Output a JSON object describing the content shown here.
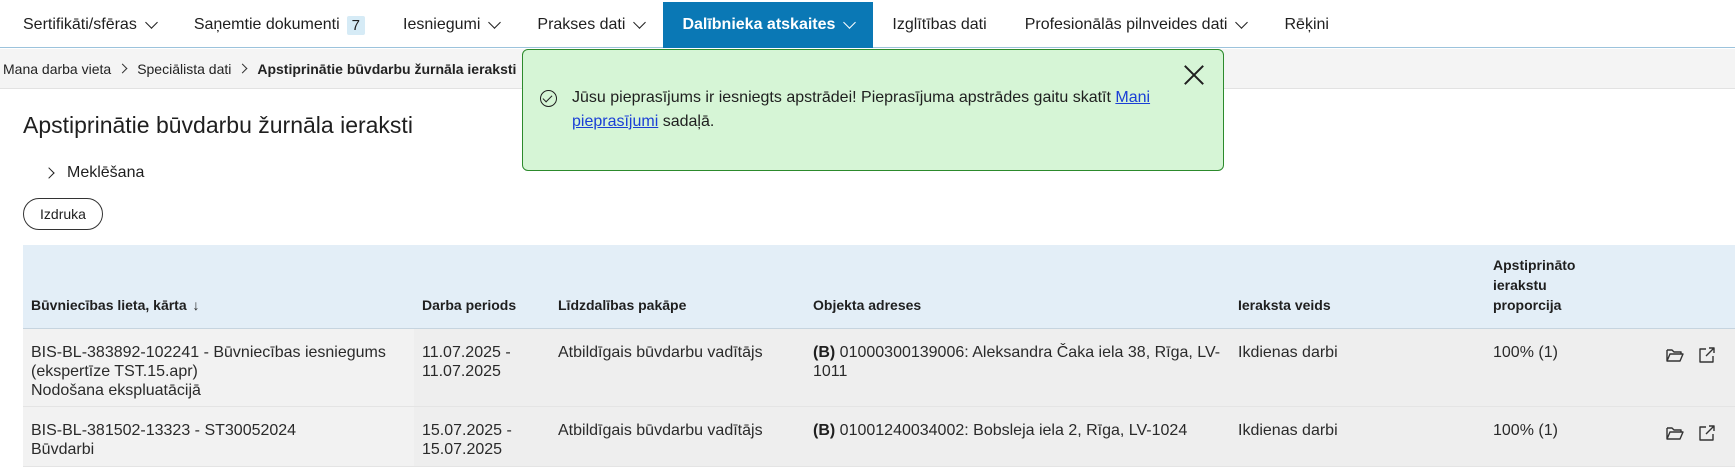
{
  "nav": {
    "items": [
      {
        "label": "Sertifikāti/sfēras",
        "dropdown": true
      },
      {
        "label": "Saņemtie dokumenti",
        "badge": "7"
      },
      {
        "label": "Iesniegumi",
        "dropdown": true
      },
      {
        "label": "Prakses dati",
        "dropdown": true
      },
      {
        "label": "Dalībnieka atskaites",
        "dropdown": true,
        "active": true
      },
      {
        "label": "Izglītības dati"
      },
      {
        "label": "Profesionālās pilnveides dati",
        "dropdown": true
      },
      {
        "label": "Rēķini"
      }
    ]
  },
  "breadcrumb": [
    "Mana darba vieta",
    "Speciālista dati",
    "Apstiprinātie būvdarbu žurnāla ieraksti"
  ],
  "toast": {
    "text_before": "Jūsu pieprasījums ir iesniegts apstrādei! Pieprasījuma apstrādes gaitu skatīt ",
    "link": "Mani pieprasījumi",
    "text_after": " sadaļā."
  },
  "page": {
    "title": "Apstiprinātie būvdarbu žurnāla ieraksti",
    "search_label": "Meklēšana",
    "print_label": "Izdruka"
  },
  "table": {
    "headers": {
      "case": "Būvniecības lieta, kārta",
      "sort_arrow": "↓",
      "period": "Darba periods",
      "role": "Līdzdalības pakāpe",
      "address": "Objekta adreses",
      "type": "Ieraksta veids",
      "ratio": [
        "Apstiprināto",
        "ierakstu",
        "proporcija"
      ]
    },
    "rows": [
      {
        "case": [
          "BIS-BL-383892-102241 - Būvniecības iesniegums",
          "(ekspertīze TST.15.apr)",
          "Nodošana ekspluatācijā"
        ],
        "period": [
          "11.07.2025 -",
          "11.07.2025"
        ],
        "role": "Atbildīgais būvdarbu vadītājs",
        "address_tag": "(B)",
        "address": [
          "01000300139006: Aleksandra Čaka iela 38, Rīga, LV-",
          "1011"
        ],
        "type": "Ikdienas darbi",
        "ratio": "100% (1)"
      },
      {
        "case": [
          "BIS-BL-381502-13323 - ST30052024",
          "Būvdarbi"
        ],
        "period": [
          "15.07.2025 -",
          "15.07.2025"
        ],
        "role": "Atbildīgais būvdarbu vadītājs",
        "address_tag": "(B)",
        "address": [
          "01001240034002: Bobsleja iela 2, Rīga, LV-1024"
        ],
        "type": "Ikdienas darbi",
        "ratio": "100% (1)"
      }
    ]
  },
  "icons": {
    "folder": "folder-open-icon",
    "external": "external-link-icon"
  },
  "colors": {
    "accent": "#0a78b5",
    "toast_bg": "#d6f5d6",
    "toast_border": "#2c8a2c",
    "table_header": "#e3eef7",
    "link": "#1a3fd6"
  }
}
